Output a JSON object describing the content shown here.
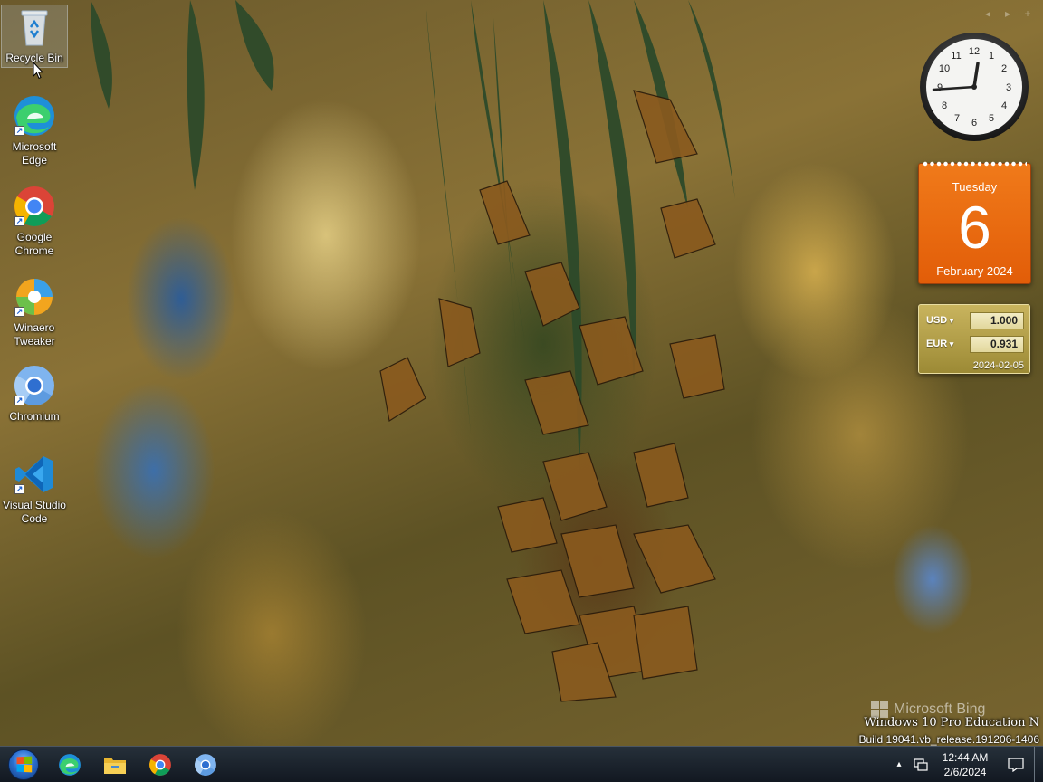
{
  "desktop": {
    "icons": [
      {
        "label": "Recycle Bin",
        "icon": "recycle-bin-icon"
      },
      {
        "label": "Microsoft Edge",
        "icon": "edge-icon",
        "shortcut": true
      },
      {
        "label": "Google Chrome",
        "icon": "chrome-icon",
        "shortcut": true
      },
      {
        "label": "Winaero Tweaker",
        "icon": "winaero-tweaker-icon",
        "shortcut": true
      },
      {
        "label": "Chromium",
        "icon": "chromium-icon",
        "shortcut": true
      },
      {
        "label": "Visual Studio Code",
        "icon": "vscode-icon",
        "shortcut": true
      }
    ]
  },
  "gadgets": {
    "controls": [
      "◂",
      "▸",
      "+"
    ],
    "clock": {
      "time": "12:44"
    },
    "calendar": {
      "weekday": "Tuesday",
      "day": "6",
      "month_year": "February 2024"
    },
    "currency": {
      "rows": [
        {
          "code": "USD",
          "value": "1.000"
        },
        {
          "code": "EUR",
          "value": "0.931"
        }
      ],
      "date": "2024-02-05"
    }
  },
  "watermark": {
    "bing": "Microsoft Bing",
    "edition": "Windows 10 Pro Education N",
    "build": "Build 19041.vb_release.191206-1406"
  },
  "taskbar": {
    "apps": [
      "edge-icon",
      "file-explorer-icon",
      "chrome-icon",
      "chromium-icon"
    ],
    "tray": {
      "chevron": "▴",
      "time": "12:44 AM",
      "date": "2/6/2024"
    }
  },
  "colors": {
    "calendar_orange": "#e8660f",
    "currency_gold": "#b9a24a",
    "taskbar": "#1b232c"
  }
}
